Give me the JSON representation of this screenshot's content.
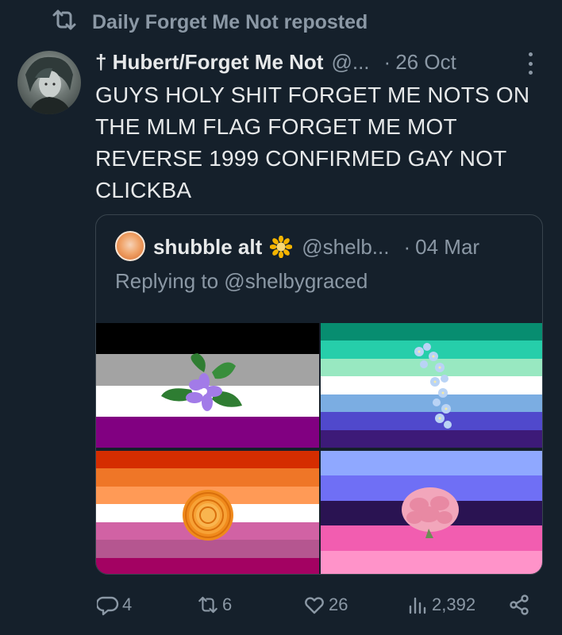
{
  "repost": {
    "text": "Daily Forget Me Not reposted"
  },
  "tweet": {
    "author": "† Hubert/Forget Me Not",
    "handle": "@...",
    "dot": "·",
    "date": "26 Oct",
    "text": "GUYS HOLY SHIT FORGET ME NOTS ON THE MLM FLAG FORGET ME MOT REVERSE 1999 CONFIRMED GAY NOT CLICKBA"
  },
  "quote": {
    "author": "shubble alt",
    "handle": "@shelb...",
    "dot": "·",
    "date": "04 Mar",
    "replying": "Replying to @shelbygraced",
    "flags": [
      {
        "name": "aromantic-asexual",
        "stripes": [
          "#000000",
          "#a3a3a3",
          "#ffffff",
          "#810081"
        ],
        "flower": "periwinkle"
      },
      {
        "name": "gay-men",
        "stripes": [
          "#078d70",
          "#26ceaa",
          "#98e8c1",
          "#ffffff",
          "#7bade2",
          "#5049cc",
          "#3d1a78"
        ],
        "flower": "forget-me-not"
      },
      {
        "name": "lesbian",
        "stripes": [
          "#d52d00",
          "#ef7627",
          "#ff9a56",
          "#ffffff",
          "#d162a4",
          "#b55690",
          "#a30262"
        ],
        "flower": "marigold"
      },
      {
        "name": "genderqueer-like",
        "stripes": [
          "#8fa8ff",
          "#6f6ff5",
          "#2a1352",
          "#f25db0",
          "#ff93c9"
        ],
        "flower": "carnation"
      }
    ]
  },
  "actions": {
    "replies": "4",
    "reposts": "6",
    "likes": "26",
    "views": "2,392"
  },
  "colors": {
    "background": "#15202b",
    "text": "#e7e9ea",
    "muted": "#8b98a5",
    "border": "#38444d"
  }
}
